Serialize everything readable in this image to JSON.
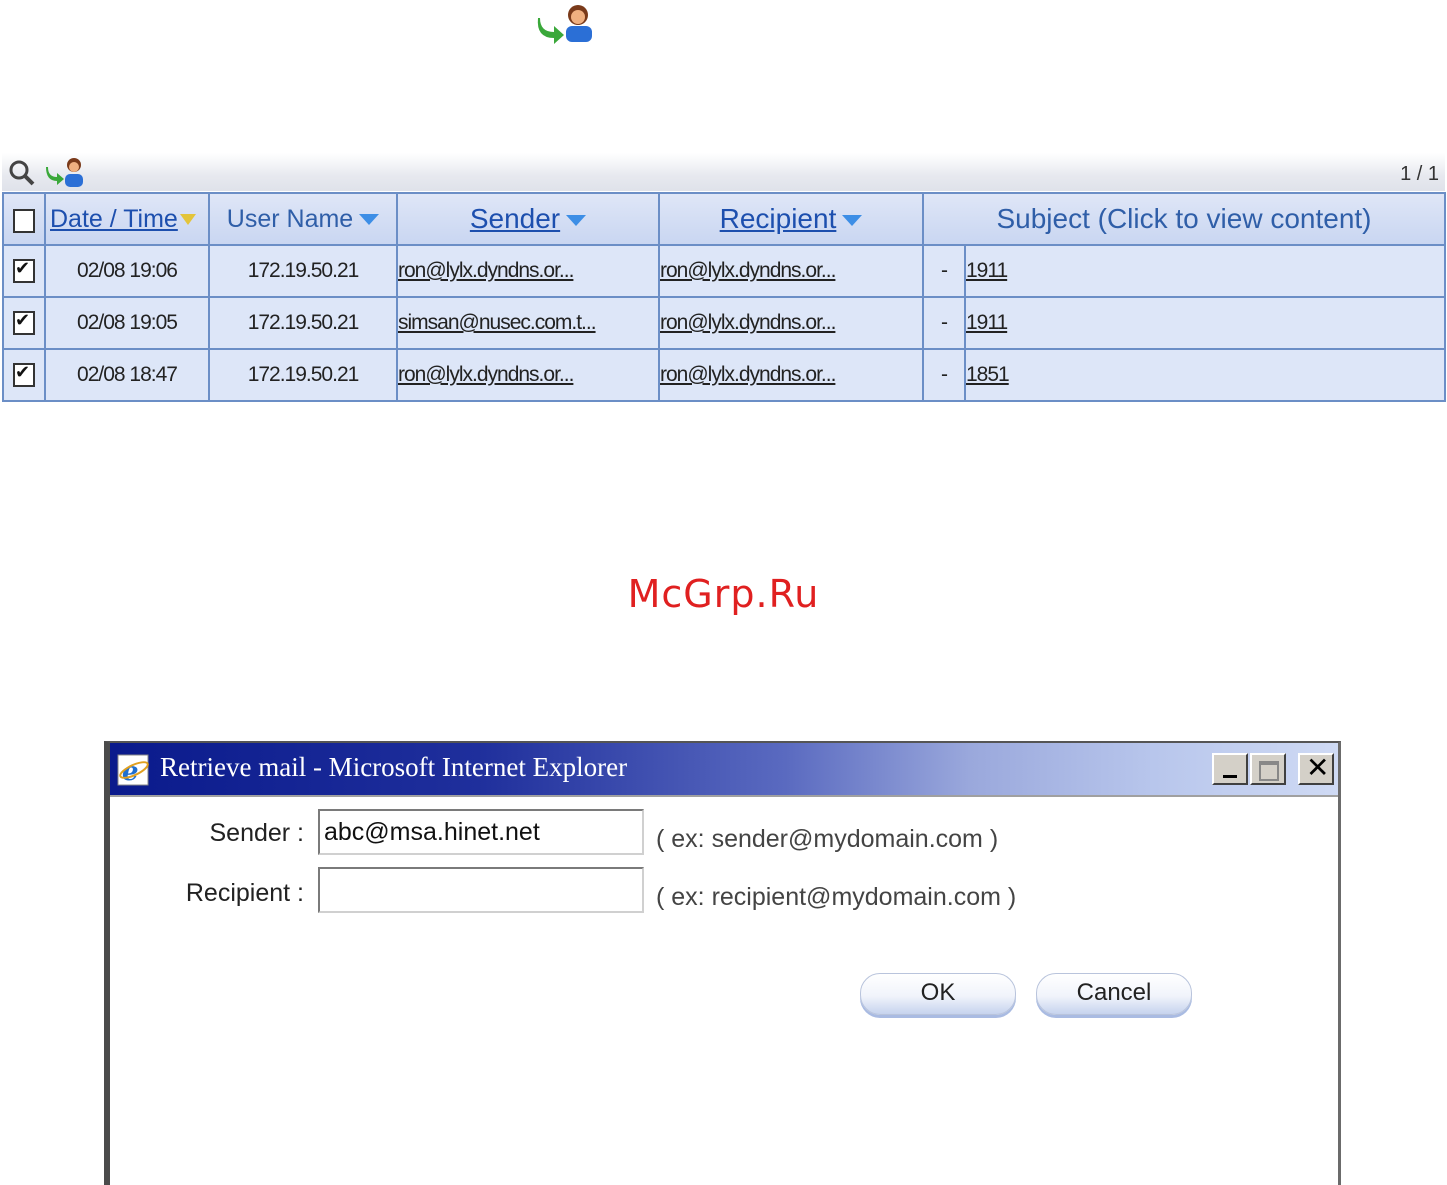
{
  "icons": {
    "top": "retrieve-mail-icon",
    "toolbar": [
      "search-icon",
      "retrieve-mail-icon"
    ]
  },
  "mail_log": {
    "page_indicator": "1 / 1",
    "columns": {
      "date_time": "Date / Time",
      "user_name": "User Name",
      "sender": "Sender",
      "recipient": "Recipient",
      "subject": "Subject (Click to view content)"
    },
    "rows": [
      {
        "checked": true,
        "date": "02/08 19:06",
        "user": "172.19.50.21",
        "sender": "ron@lylx.dyndns.or...",
        "recipient": "ron@lylx.dyndns.or...",
        "dash": "-",
        "subject": "1911"
      },
      {
        "checked": true,
        "date": "02/08 19:05",
        "user": "172.19.50.21",
        "sender": "simsan@nusec.com.t...",
        "recipient": "ron@lylx.dyndns.or...",
        "dash": "-",
        "subject": "1911"
      },
      {
        "checked": true,
        "date": "02/08 18:47",
        "user": "172.19.50.21",
        "sender": "ron@lylx.dyndns.or...",
        "recipient": "ron@lylx.dyndns.or...",
        "dash": "-",
        "subject": "1851"
      }
    ]
  },
  "watermark": "McGrp.Ru",
  "dialog": {
    "title": "Retrieve mail - Microsoft Internet Explorer",
    "sender_label": "Sender :",
    "sender_value": "abc@msa.hinet.net",
    "sender_hint": "( ex: sender@mydomain.com )",
    "recipient_label": "Recipient :",
    "recipient_value": "",
    "recipient_hint": "( ex: recipient@mydomain.com )",
    "ok": "OK",
    "cancel": "Cancel"
  },
  "colors": {
    "accent": "#1d4fae",
    "table_row_bg": "#dde6f8",
    "watermark": "#e02020",
    "title_bar_start": "#0a1a8c"
  }
}
